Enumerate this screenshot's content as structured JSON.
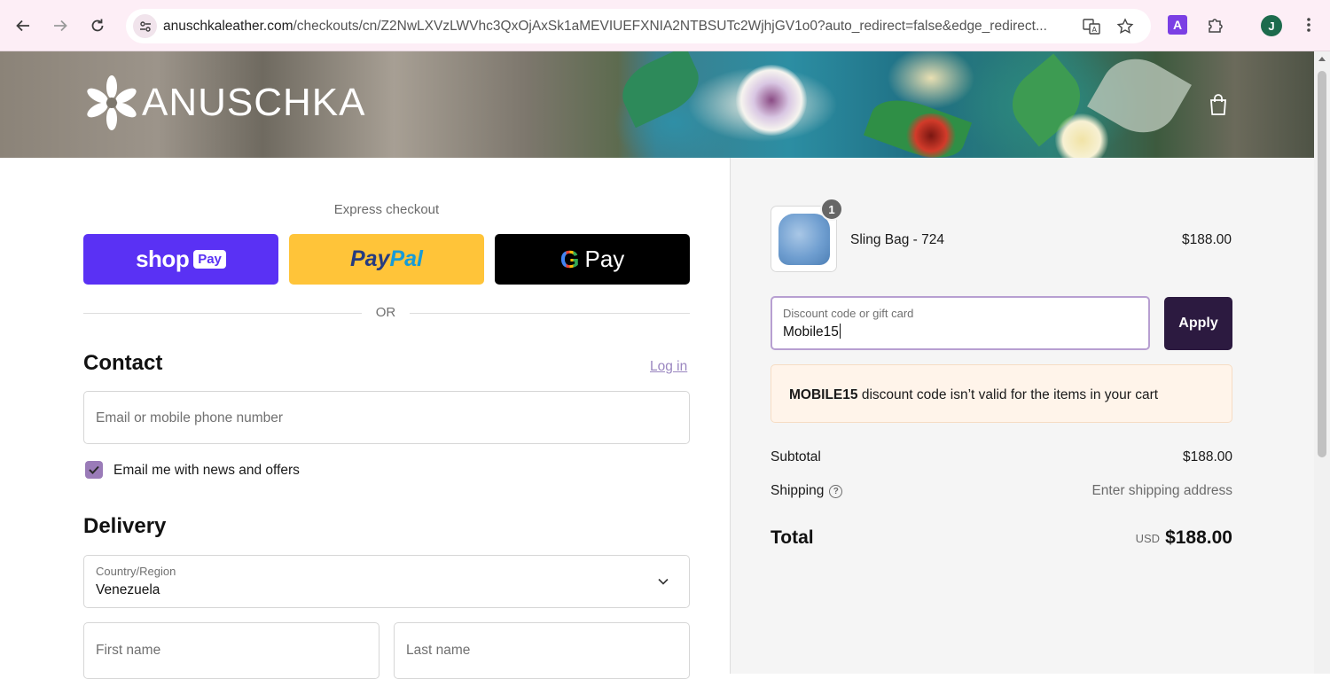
{
  "browser": {
    "url_host": "anuschkaleather.com",
    "url_path": "/checkouts/cn/Z2NwLXVzLWVhc3QxOjAxSk1aMEVIUEFXNIA2NTBSUTc2WjhjGV1o0?auto_redirect=false&edge_redirect...",
    "profile_initial": "J",
    "extension_letter": "A"
  },
  "brand": {
    "logo_text": "ANUSCHKA"
  },
  "express": {
    "label": "Express checkout",
    "shop_label": "shop",
    "shop_pay_pill": "Pay",
    "paypal_part1": "Pay",
    "paypal_part2": "Pal",
    "gpay_g": "G",
    "gpay_label": "Pay",
    "or_text": "OR"
  },
  "contact": {
    "heading": "Contact",
    "login_label": "Log in",
    "email_placeholder": "Email or mobile phone number",
    "newsletter_label": "Email me with news and offers",
    "newsletter_checked": true
  },
  "delivery": {
    "heading": "Delivery",
    "country_label": "Country/Region",
    "country_value": "Venezuela",
    "first_name_placeholder": "First name",
    "last_name_placeholder": "Last name"
  },
  "summary": {
    "item": {
      "name": "Sling Bag - 724",
      "price": "$188.00",
      "quantity": "1"
    },
    "discount_label": "Discount code or gift card",
    "discount_value": "Mobile15",
    "apply_label": "Apply",
    "error_code": "MOBILE15",
    "error_message": " discount code isn’t valid for the items in your cart",
    "subtotal_label": "Subtotal",
    "subtotal_value": "$188.00",
    "shipping_label": "Shipping",
    "shipping_value": "Enter shipping address",
    "total_label": "Total",
    "total_currency": "USD",
    "total_value": "$188.00"
  },
  "colors": {
    "shop_pay": "#5a31f4",
    "paypal": "#ffc439",
    "apply_button": "#2c1a40",
    "accent": "#9a7bb8",
    "error_bg": "#fff4ea"
  }
}
